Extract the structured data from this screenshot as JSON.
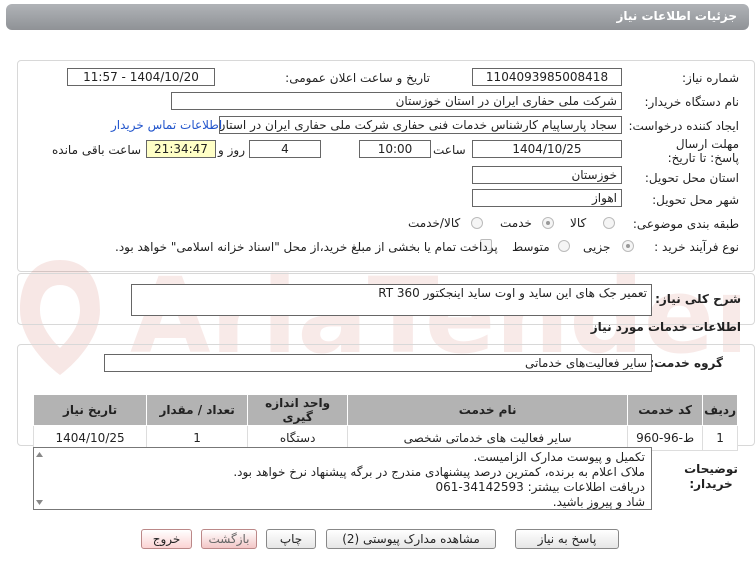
{
  "header": {
    "title": "جزئیات اطلاعات نیاز"
  },
  "fields": {
    "need_number_label": "شماره نیاز:",
    "need_number": "1104093985008418",
    "announce_label": "تاریخ و ساعت اعلان عمومی:",
    "announce_value": "1404/10/20 - 11:57",
    "buyer_label": "نام دستگاه خریدار:",
    "buyer_value": "شرکت ملی حفاری ایران در استان خوزستان",
    "creator_label": "ایجاد کننده درخواست:",
    "creator_value": "سجاد پارساپیام کارشناس خدمات فنی حفاری شرکت ملی حفاری ایران در استان",
    "contact_link": "اطلاعات تماس خریدار",
    "deadline_label": "مهلت ارسال پاسخ: تا تاریخ:",
    "deadline_date": "1404/10/25",
    "time_label": "ساعت",
    "deadline_time": "10:00",
    "days_value": "4",
    "days_label": "روز و",
    "remaining_time": "21:34:47",
    "remaining_label": "ساعت باقی مانده",
    "province_label": "استان محل تحویل:",
    "province_value": "خوزستان",
    "city_label": "شهر محل تحویل:",
    "city_value": "اهواز",
    "category_label": "طبقه بندی موضوعی:",
    "category_options": [
      "کالا",
      "خدمت",
      "کالا/خدمت"
    ],
    "category_selected": "خدمت",
    "process_label": "نوع فرآیند خرید :",
    "process_options": [
      "جزیی",
      "متوسط"
    ],
    "process_selected": "جزیی",
    "payment_note": "پرداخت تمام یا بخشی از مبلغ خرید،از محل \"اسناد خزانه اسلامی\" خواهد بود."
  },
  "description": {
    "label": "شرح کلی نیاز:",
    "value": "تعمیر جک های این ساید و اوت ساید اینجکتور RT 360"
  },
  "services_section": {
    "title": "اطلاعات خدمات مورد نیاز",
    "group_label": "گروه خدمت:",
    "group_value": "سایر فعالیت‌های خدماتی"
  },
  "table": {
    "headers": [
      "ردیف",
      "کد خدمت",
      "نام خدمت",
      "واحد اندازه گیری",
      "تعداد / مقدار",
      "تاریخ نیاز"
    ],
    "rows": [
      [
        "1",
        "ط-96-960",
        "سایر فعالیت های خدماتی شخصی",
        "دستگاه",
        "1",
        "1404/10/25"
      ]
    ]
  },
  "notes": {
    "label": "توضیحات خریدار:",
    "lines": [
      "تکمیل و پیوست مدارک الزامیست.",
      "ملاک اعلام به برنده، کمترین درصد پیشنهادی مندرج در برگه پیشنهاد نرخ خواهد بود.",
      "دریافت اطلاعات بیشتر: 34142593-061",
      "شاد و پیروز باشید."
    ]
  },
  "buttons": {
    "reply": "پاسخ به نیاز",
    "attachments": "مشاهده مدارک پیوستی (2)",
    "print": "چاپ",
    "back": "بازگشت",
    "exit": "خروج"
  },
  "watermark": {
    "text": "AriaTender.net"
  },
  "colors": {
    "title_bar": "#9a9da1",
    "link": "#2255cc",
    "table_header": "#b3b3b3",
    "highlight": "#ffffc6"
  }
}
